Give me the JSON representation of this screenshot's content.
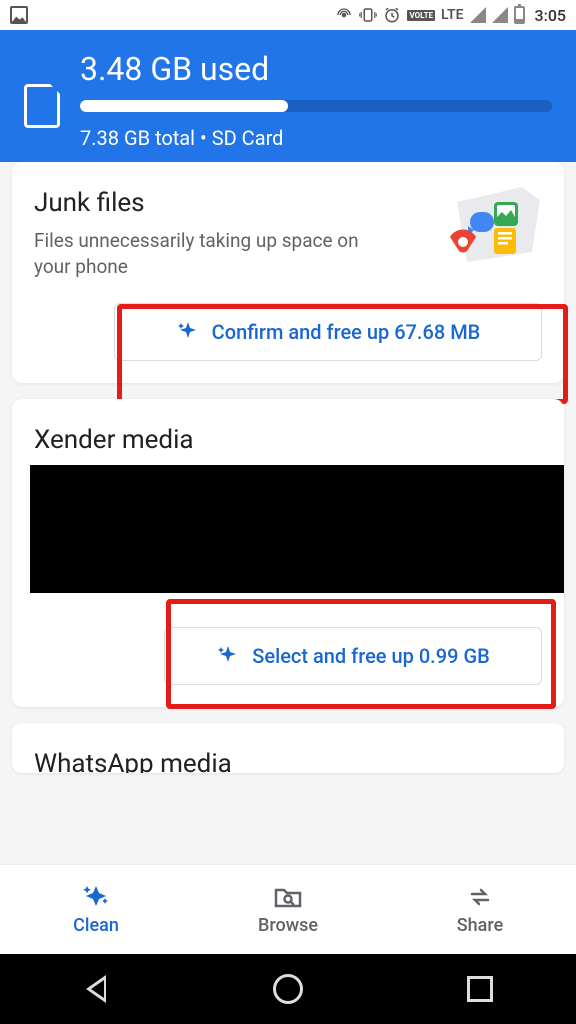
{
  "status": {
    "time": "3:05",
    "network": "LTE",
    "volte": "VOLTE"
  },
  "header": {
    "used": "3.48 GB used",
    "total": "7.38 GB total • SD Card",
    "progress_pct": 44
  },
  "cards": {
    "junk": {
      "title": "Junk files",
      "subtitle": "Files unnecessarily taking up space on your phone",
      "action": "Confirm and free up 67.68 MB"
    },
    "xender": {
      "title": "Xender media",
      "action": "Select and free up 0.99 GB"
    },
    "whatsapp": {
      "title": "WhatsApp media"
    }
  },
  "nav": {
    "clean": "Clean",
    "browse": "Browse",
    "share": "Share"
  }
}
